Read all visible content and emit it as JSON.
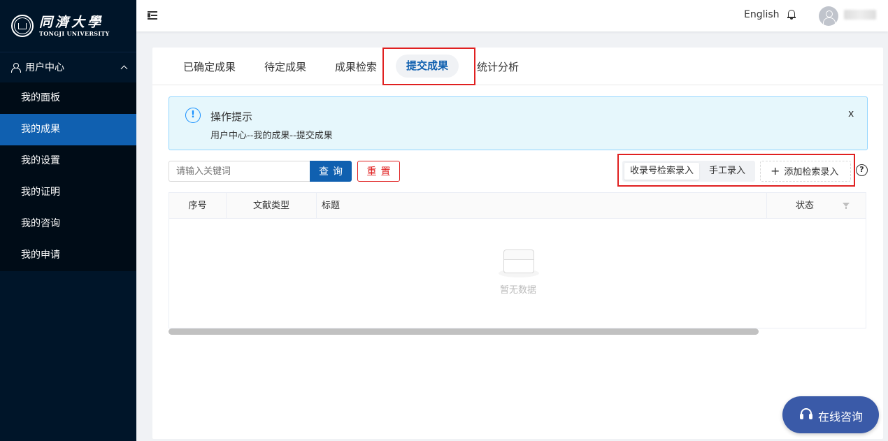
{
  "brand": {
    "name_cn": "同濟大學",
    "name_en": "TONGJI UNIVERSITY"
  },
  "sidebar": {
    "group_label": "用户中心",
    "items": [
      {
        "label": "我的面板",
        "active": false
      },
      {
        "label": "我的成果",
        "active": true
      },
      {
        "label": "我的设置",
        "active": false
      },
      {
        "label": "我的证明",
        "active": false
      },
      {
        "label": "我的咨询",
        "active": false
      },
      {
        "label": "我的申请",
        "active": false
      }
    ]
  },
  "header": {
    "language": "English"
  },
  "tabs": [
    {
      "label": "已确定成果",
      "active": false
    },
    {
      "label": "待定成果",
      "active": false
    },
    {
      "label": "成果检索",
      "active": false
    },
    {
      "label": "提交成果",
      "active": true
    },
    {
      "label": "统计分析",
      "active": false
    }
  ],
  "alert": {
    "title": "操作提示",
    "description": "用户中心--我的成果--提交成果",
    "close": "x"
  },
  "search": {
    "placeholder": "请输入关键词",
    "query_label": "查询",
    "reset_label": "重置"
  },
  "entry_modes": {
    "options": [
      {
        "label": "收录号检索录入",
        "active": true
      },
      {
        "label": "手工录入",
        "active": false
      }
    ],
    "add_label": "添加检索录入",
    "help": "?"
  },
  "table": {
    "columns": [
      "序号",
      "文献类型",
      "标题",
      "状态"
    ],
    "empty_text": "暂无数据"
  },
  "consult": {
    "label": "在线咨询"
  },
  "colors": {
    "sidebar_bg": "#001529",
    "primary": "#1060b0",
    "danger": "#e02020",
    "alert_bg": "#e6f7fc",
    "consult_bg": "#3a5aa8"
  }
}
